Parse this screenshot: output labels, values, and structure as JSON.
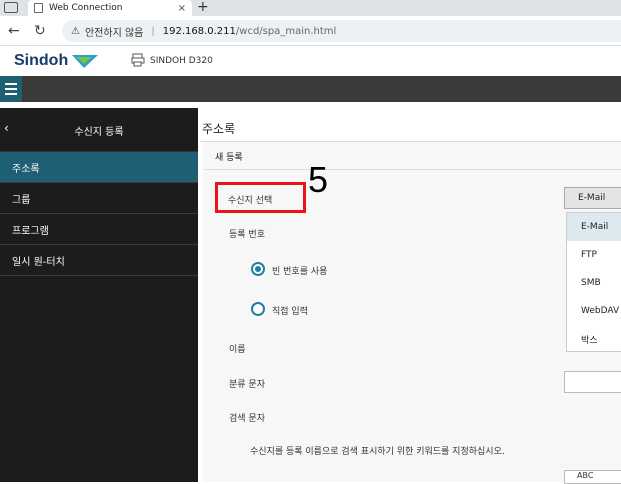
{
  "browser": {
    "tab_title": "Web Connection",
    "tab_close": "×",
    "new_tab": "+",
    "insecure_label": "안전하지 않음",
    "url_host": "192.168.0.211",
    "url_path": "/wcd/spa_main.html"
  },
  "header": {
    "logo": "Sindoh",
    "model": "SINDOH D320"
  },
  "sidebar": {
    "back": "‹",
    "title": "수신지 등록",
    "items": [
      {
        "label": "주소록"
      },
      {
        "label": "그룹"
      },
      {
        "label": "프로그램"
      },
      {
        "label": "일시 원-터치"
      }
    ]
  },
  "main": {
    "page_title": "주소록",
    "section_title": "새 등록",
    "dest_select_label": "수신지 선택",
    "step_number": "5",
    "reg_number_label": "등록 번호",
    "radio_use_empty": "빈 번호를 사용",
    "radio_direct": "직접 입력",
    "name_label": "이름",
    "class_label": "분류 문자",
    "search_label": "검색 문자",
    "search_hint": "수신지를 등록 이름으로 검색 표시하기 위한 키워드를 지정하십시오.",
    "select_value": "E-Mail",
    "dropdown_options": [
      "E-Mail",
      "FTP",
      "SMB",
      "WebDAV",
      "박스"
    ],
    "bottom_value": "ABC"
  },
  "colors": {
    "accent": "#1e5f73",
    "sidebar_bg": "#1c1c1c",
    "highlight": "#e8141b"
  }
}
